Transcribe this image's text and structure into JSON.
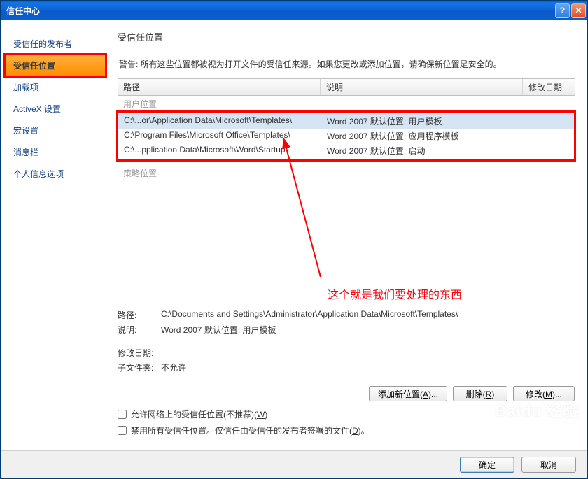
{
  "title": "信任中心",
  "sidebar": {
    "items": [
      {
        "label": "受信任的发布者"
      },
      {
        "label": "受信任位置",
        "selected": true
      },
      {
        "label": "加载项"
      },
      {
        "label": "ActiveX 设置"
      },
      {
        "label": "宏设置"
      },
      {
        "label": "消息栏"
      },
      {
        "label": "个人信息选项"
      }
    ]
  },
  "main": {
    "title": "受信任位置",
    "warning": "警告: 所有这些位置都被视为打开文件的受信任来源。如果您更改或添加位置，请确保新位置是安全的。",
    "columns": {
      "path": "路径",
      "desc": "说明",
      "date": "修改日期"
    },
    "group_user": "用户位置",
    "group_policy": "策略位置",
    "rows": [
      {
        "path": "C:\\...or\\Application Data\\Microsoft\\Templates\\",
        "desc": "Word 2007 默认位置: 用户模板",
        "selected": true
      },
      {
        "path": "C:\\Program Files\\Microsoft Office\\Templates\\",
        "desc": "Word 2007 默认位置: 应用程序模板"
      },
      {
        "path": "C:\\...pplication Data\\Microsoft\\Word\\Startup\\",
        "desc": "Word 2007 默认位置: 启动"
      }
    ],
    "details": {
      "path_label": "路径:",
      "path_value": "C:\\Documents and Settings\\Administrator\\Application Data\\Microsoft\\Templates\\",
      "desc_label": "说明:",
      "desc_value": "Word 2007 默认位置: 用户模板",
      "date_label": "修改日期:",
      "date_value": "",
      "sub_label": "子文件夹:",
      "sub_value": "不允许"
    },
    "buttons": {
      "add": "添加新位置(A)...",
      "remove": "删除(R)",
      "modify": "修改(M)..."
    },
    "checkboxes": {
      "network": "允许网络上的受信任位置(不推荐)(W)",
      "disable": "禁用所有受信任位置。仅信任由受信任的发布者签署的文件(D)。"
    }
  },
  "footer": {
    "ok": "确定",
    "cancel": "取消"
  },
  "annotation": "这个就是我们要处理的东西",
  "watermark": "Baidu 经验"
}
